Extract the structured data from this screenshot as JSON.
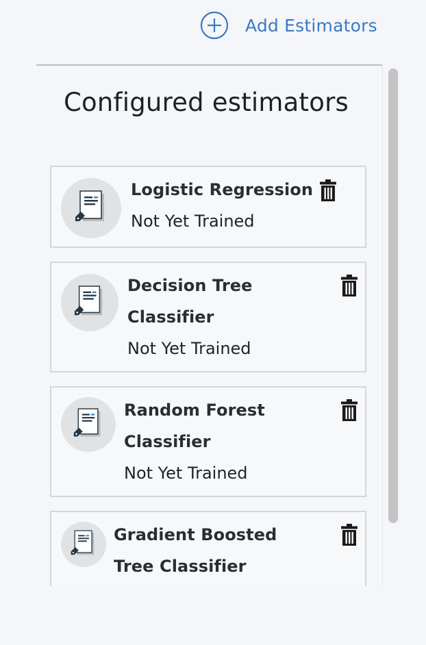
{
  "header": {
    "add_label": "Add Estimators",
    "add_icon": "plus-circle-icon",
    "accent": "#3b78c4"
  },
  "panel": {
    "title": "Configured estimators"
  },
  "estimators": [
    {
      "name": "Logistic Regression",
      "status": "Not Yet Trained",
      "icon": "model-document-tag-icon"
    },
    {
      "name": "Decision Tree Classifier",
      "status": "Not Yet Trained",
      "icon": "model-document-tag-icon"
    },
    {
      "name": "Random Forest Classifier",
      "status": "Not Yet Trained",
      "icon": "model-document-tag-icon"
    },
    {
      "name": "Gradient Boosted Tree Classifier",
      "status": "",
      "icon": "model-document-tag-icon"
    }
  ],
  "delete_icon": "trash-icon"
}
